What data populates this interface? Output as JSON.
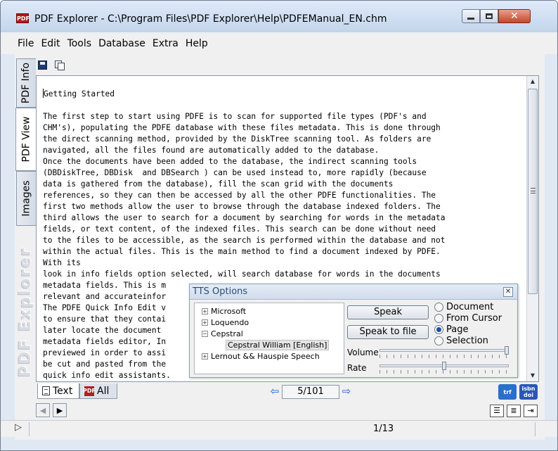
{
  "window": {
    "app_icon": "PDF",
    "title": "PDF Explorer - C:\\Program Files\\PDF Explorer\\Help\\PDFEManual_EN.chm",
    "controls": {
      "close": "✕"
    }
  },
  "menu": {
    "items": [
      "File",
      "Edit",
      "Tools",
      "Database",
      "Extra",
      "Help"
    ]
  },
  "toolbar": {
    "icons": [
      "save-icon",
      "copy-icon"
    ]
  },
  "side_tabs": [
    "PDF Info",
    "PDF View",
    "Images"
  ],
  "brand_watermark": "PDF Explorer",
  "document": {
    "lines": [
      "Getting Started",
      "",
      "The first step to start using PDFE is to scan for supported file types (PDF's and",
      "CHM's), populating the PDFE database with these files metadata. This is done through",
      "the direct scanning method, provided by the DiskTree scanning tool. As folders are",
      "navigated, all the files found are automatically added to the database.",
      "Once the documents have been added to the database, the indirect scanning tools",
      "(DBDiskTree, DBDisk  and DBSearch ) can be used instead to, more rapidly (because",
      "data is gathered from the database), fill the scan grid with the documents",
      "references, so they can then be accessed by all the other PDFE functionalities. The",
      "first two methods allow the user to browse through the database indexed folders. The",
      "third allows the user to search for a document by searching for words in the metadata",
      "fields, or text content, of the indexed files. This search can be done without need",
      "to the files to be accessible, as the search is performed within the database and not",
      "within the actual files. This is the main method to find a document indexed by PDFE.",
      "With its",
      "look in info fields option selected, will search database for words in the documents",
      "metadata fields. This is m",
      "relevant and accurateinfor",
      "The PDFE Quick Info Edit v",
      "to ensure that they contai",
      "later locate the document",
      "metadata fields editor, In",
      "previewed in order to assi",
      "be cut and pasted from the",
      "quick info edit assistants."
    ]
  },
  "bottom_tabs": {
    "text": "Text",
    "all": "All",
    "all_icon_label": "PDF"
  },
  "navigation": {
    "prev": "⇦",
    "next": "⇨",
    "page_counter": "5/101",
    "first": "◀",
    "last": "▶"
  },
  "badges": {
    "trf": "trf",
    "isbn_top": "isbn",
    "isbn_bottom": "doi"
  },
  "status": {
    "play": "▷",
    "page": "1/13"
  },
  "tts": {
    "title": "TTS Options",
    "close": "✕",
    "voices": [
      {
        "name": "Microsoft",
        "expander": "+"
      },
      {
        "name": "Loquendo",
        "expander": "+"
      },
      {
        "name": "Cepstral",
        "expander": "−"
      },
      {
        "name": "Cepstral William [English]",
        "child": true
      },
      {
        "name": "Lernout && Hauspie Speech",
        "expander": "+"
      }
    ],
    "speak_label": "Speak",
    "speak_file_label": "Speak to file",
    "options": [
      {
        "label": "Document",
        "checked": false
      },
      {
        "label": "From Cursor",
        "checked": false
      },
      {
        "label": "Page",
        "checked": true
      },
      {
        "label": "Selection",
        "checked": false
      }
    ],
    "volume_label": "Volume",
    "rate_label": "Rate",
    "volume_level": 1.0,
    "rate_level": 0.5
  }
}
